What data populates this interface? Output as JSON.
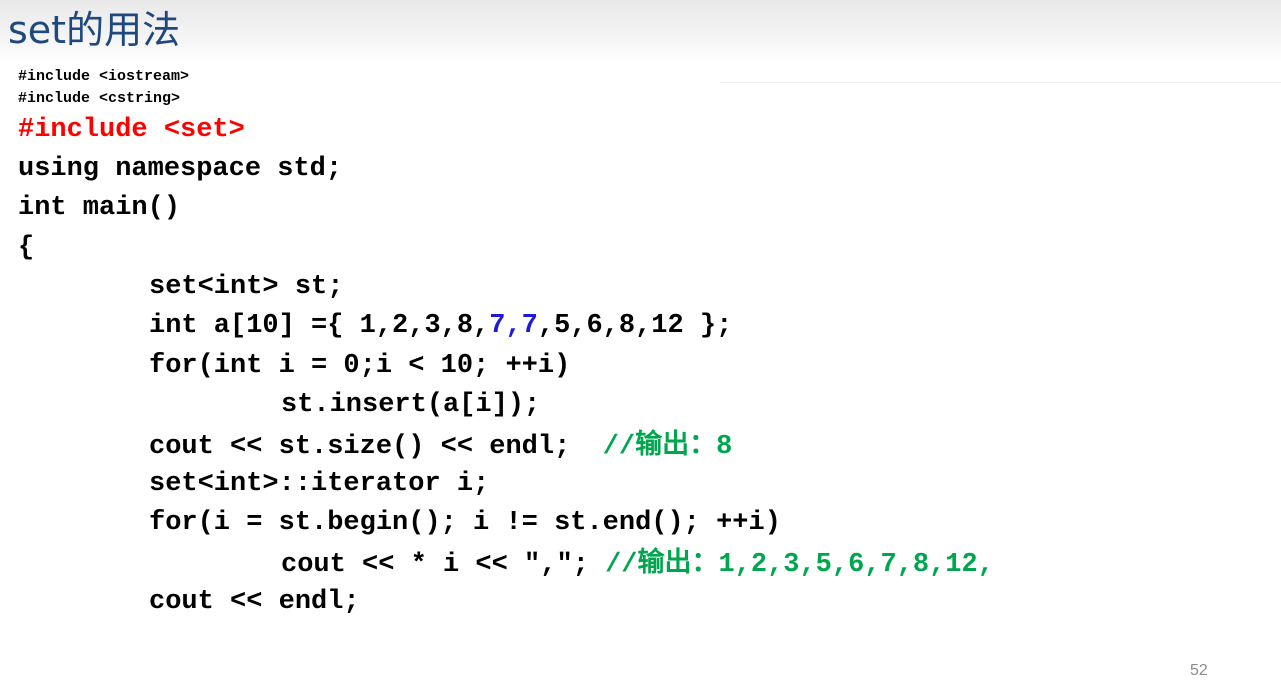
{
  "slide": {
    "title": "set的用法",
    "page_number": "52"
  },
  "code": {
    "line1": "#include <iostream>",
    "line2": "#include <cstring>",
    "line3": "#include <set>",
    "line4": "using namespace std;",
    "line5": "int main()",
    "line6": "{",
    "line7": "set<int> st;",
    "line8_a": "int a[10] ={ 1,2,3,8,",
    "line8_b": "7,7",
    "line8_c": ",5,6,8,12 };",
    "line9": "for(int i = 0;i < 10; ++i)",
    "line10": "st.insert(a[i]);",
    "line11_code": "cout << st.size() << endl;  ",
    "line11_comment_prefix": "//",
    "line11_comment_cjk": "输出：",
    "line11_comment_value": "8",
    "line12": "set<int>::iterator i;",
    "line13": "for(i = st.begin(); i != st.end(); ++i)",
    "line14_code": "cout << * i << \",\"; ",
    "line14_comment_prefix": "//",
    "line14_comment_cjk": "输出：",
    "line14_comment_value": "1,2,3,5,6,7,8,12,",
    "line15": "cout << endl;"
  },
  "colors": {
    "title": "#1f497d",
    "highlight_include": "#ff0000",
    "highlight_values": "#1c1cd8",
    "comment": "#00a64e"
  }
}
